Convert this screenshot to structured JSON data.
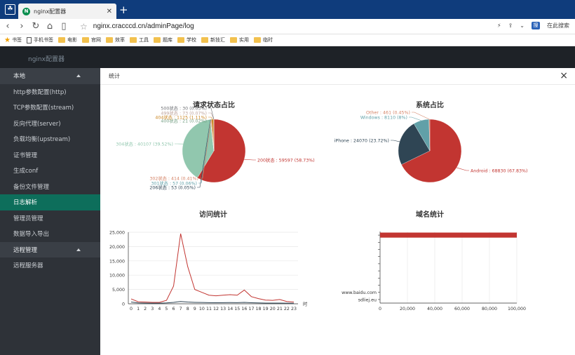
{
  "browser": {
    "tab_title": "nginx配置器",
    "url": "nginx.cracccd.cn/adminPage/log",
    "search_label": "在此搜索",
    "bookmarks": [
      "书签",
      "手机书签",
      "电影",
      "官网",
      "效率",
      "工具",
      "题库",
      "学校",
      "新技汇",
      "实用",
      "临时"
    ]
  },
  "app": {
    "brand": "nginx配置器"
  },
  "sidebar": {
    "items": [
      {
        "label": "本地",
        "kind": "group"
      },
      {
        "label": "http参数配置(http)",
        "kind": "item"
      },
      {
        "label": "TCP参数配置(stream)",
        "kind": "item"
      },
      {
        "label": "反向代理(server)",
        "kind": "item"
      },
      {
        "label": "负载均衡(upstream)",
        "kind": "item"
      },
      {
        "label": "证书管理",
        "kind": "item"
      },
      {
        "label": "生成conf",
        "kind": "item"
      },
      {
        "label": "备份文件管理",
        "kind": "item"
      },
      {
        "label": "日志解析",
        "kind": "active"
      },
      {
        "label": "管理员管理",
        "kind": "item"
      },
      {
        "label": "数据导入导出",
        "kind": "item"
      },
      {
        "label": "远程管理",
        "kind": "group"
      },
      {
        "label": "远程服务器",
        "kind": "item"
      }
    ]
  },
  "modal": {
    "title": "统计",
    "close": "×"
  },
  "chart_data": [
    {
      "type": "pie",
      "title": "请求状态占比",
      "slices": [
        {
          "label": "200状态 : 59597 (58.73%)",
          "value": 59597,
          "color": "#c23531"
        },
        {
          "label": "304状态 : 40107 (39.52%)",
          "value": 40107,
          "color": "#91c7ae"
        },
        {
          "label": "206状态 : 53 (0.05%)",
          "value": 53,
          "color": "#2f4554"
        },
        {
          "label": "301状态 : 57 (0.06%)",
          "value": 57,
          "color": "#61a0a8"
        },
        {
          "label": "302状态 : 414 (0.41%)",
          "value": 414,
          "color": "#d48265"
        },
        {
          "label": "400状态 : 21 (0.02%)",
          "value": 21,
          "color": "#749f83"
        },
        {
          "label": "404状态 : 1125 (1.11%)",
          "value": 1125,
          "color": "#ca8622"
        },
        {
          "label": "499状态 : 73 (0.07%)",
          "value": 73,
          "color": "#bda29a"
        },
        {
          "label": "500状态 : 30 (0.03%)",
          "value": 30,
          "color": "#6e7074"
        }
      ]
    },
    {
      "type": "pie",
      "title": "系统占比",
      "slices": [
        {
          "label": "Android : 68830 (67.83%)",
          "value": 68830,
          "color": "#c23531"
        },
        {
          "label": "iPhone : 24070 (23.72%)",
          "value": 24070,
          "color": "#2f4554"
        },
        {
          "label": "Windows : 8110 (8%)",
          "value": 8110,
          "color": "#61a0a8"
        },
        {
          "label": "Other : 461 (0.45%)",
          "value": 461,
          "color": "#d48265"
        }
      ]
    },
    {
      "type": "line",
      "title": "访问统计",
      "x": [
        "0",
        "1",
        "2",
        "3",
        "4",
        "5",
        "6",
        "7",
        "8",
        "9",
        "10",
        "11",
        "12",
        "13",
        "14",
        "15",
        "16",
        "17",
        "18",
        "19",
        "20",
        "21",
        "22",
        "23"
      ],
      "xunit": "时",
      "ylim": [
        0,
        25000
      ],
      "yticks": [
        "0",
        "5,000",
        "10,000",
        "15,000",
        "20,000",
        "25,000"
      ],
      "series": [
        {
          "color": "#c23531",
          "values": [
            1700,
            700,
            600,
            500,
            500,
            1200,
            6200,
            24500,
            13000,
            5000,
            4000,
            3000,
            2800,
            3000,
            3200,
            3000,
            4800,
            2500,
            1800,
            1300,
            1200,
            1500,
            800,
            600
          ]
        },
        {
          "color": "#2f4554",
          "values": [
            600,
            300,
            250,
            200,
            200,
            300,
            500,
            800,
            600,
            500,
            450,
            400,
            380,
            400,
            420,
            400,
            500,
            380,
            300,
            250,
            230,
            250,
            200,
            180
          ]
        }
      ]
    },
    {
      "type": "bar",
      "orientation": "horizontal",
      "title": "域名统计",
      "categories": [
        "",
        "",
        "",
        "",
        "",
        "",
        "",
        "",
        "www.baidu.com",
        "sdliej.eu"
      ],
      "values": [
        100000,
        0,
        0,
        0,
        0,
        0,
        0,
        0,
        0,
        0
      ],
      "xlim": [
        0,
        100000
      ],
      "xticks": [
        "0",
        "20,000",
        "40,000",
        "60,000",
        "80,000",
        "100,000"
      ],
      "color": "#c23531"
    }
  ]
}
